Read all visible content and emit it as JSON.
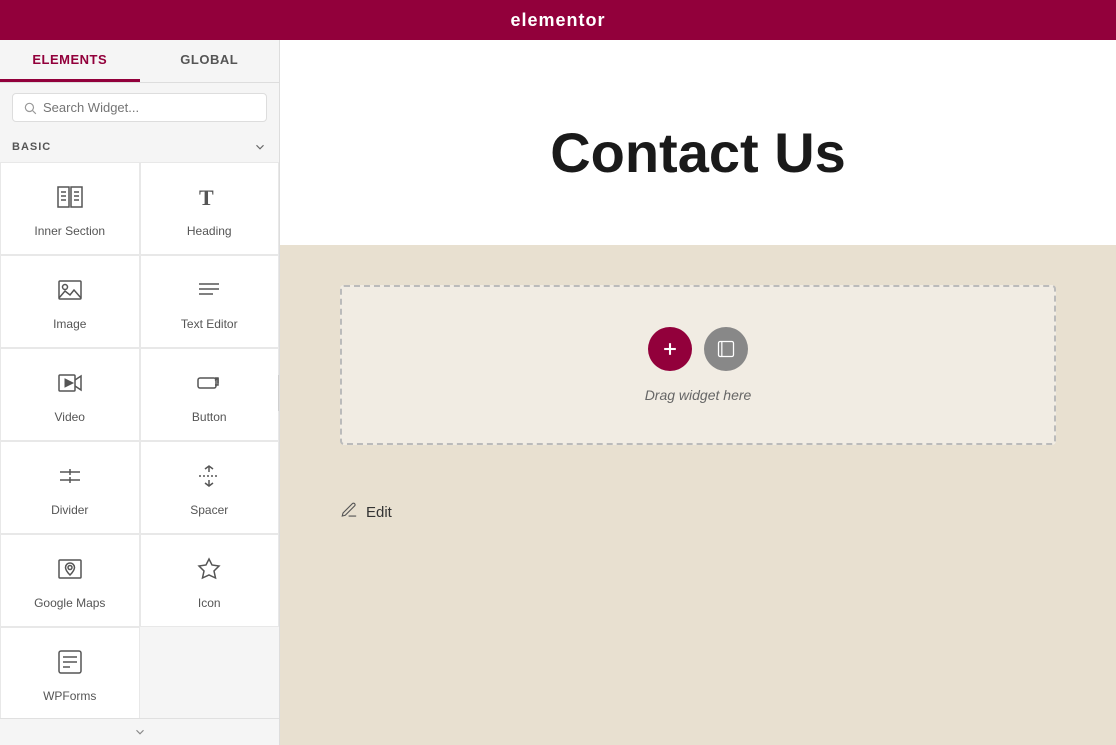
{
  "header": {
    "logo": "elementor",
    "hamburger_icon": "hamburger-icon",
    "grid_icon": "grid-icon"
  },
  "sidebar": {
    "tabs": [
      {
        "id": "elements",
        "label": "ELEMENTS",
        "active": true
      },
      {
        "id": "global",
        "label": "GLOBAL",
        "active": false
      }
    ],
    "search": {
      "placeholder": "Search Widget..."
    },
    "sections": [
      {
        "id": "basic",
        "label": "BASIC",
        "widgets": [
          {
            "id": "inner-section",
            "label": "Inner Section",
            "icon": "inner-section-icon"
          },
          {
            "id": "heading",
            "label": "Heading",
            "icon": "heading-icon"
          },
          {
            "id": "image",
            "label": "Image",
            "icon": "image-icon"
          },
          {
            "id": "text-editor",
            "label": "Text Editor",
            "icon": "text-editor-icon"
          },
          {
            "id": "video",
            "label": "Video",
            "icon": "video-icon"
          },
          {
            "id": "button",
            "label": "Button",
            "icon": "button-icon"
          },
          {
            "id": "divider",
            "label": "Divider",
            "icon": "divider-icon"
          },
          {
            "id": "spacer",
            "label": "Spacer",
            "icon": "spacer-icon"
          },
          {
            "id": "google-maps",
            "label": "Google Maps",
            "icon": "google-maps-icon"
          },
          {
            "id": "icon",
            "label": "Icon",
            "icon": "icon-widget-icon"
          },
          {
            "id": "wpforms",
            "label": "WPForms",
            "icon": "wpforms-icon"
          }
        ]
      }
    ]
  },
  "content": {
    "page_title": "Contact Us",
    "drop_zone_text": "Drag widget here",
    "edit_label": "Edit"
  },
  "colors": {
    "brand": "#92003b",
    "background": "#e8e0d0",
    "sidebar_bg": "#f5f5f5"
  }
}
